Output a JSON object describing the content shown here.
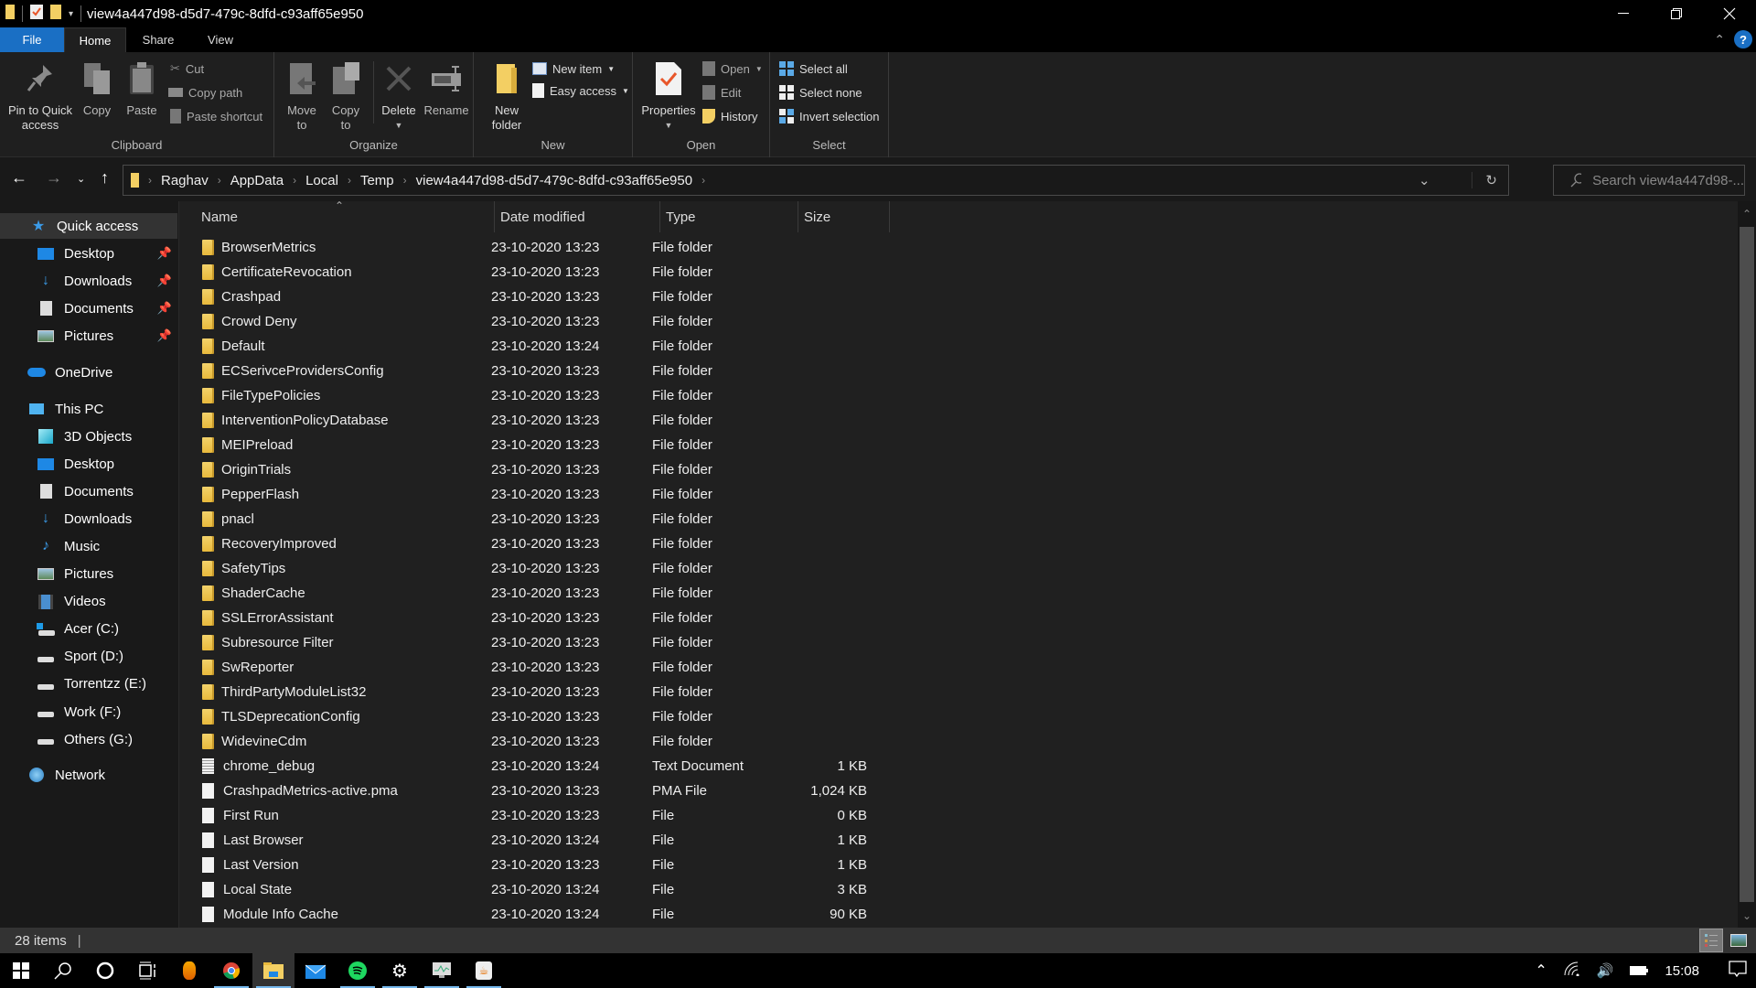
{
  "window": {
    "title": "view4a447d98-d5d7-479c-8dfd-c93aff65e950",
    "controls": {
      "minimize": "minimize-icon",
      "restore": "restore-icon",
      "close": "close-icon"
    }
  },
  "ribbon_tabs": [
    {
      "label": "File"
    },
    {
      "label": "Home",
      "active": true
    },
    {
      "label": "Share"
    },
    {
      "label": "View"
    }
  ],
  "ribbon": {
    "clipboard": {
      "label": "Clipboard",
      "pin": "Pin to Quick access",
      "pin_line1": "Pin to Quick",
      "pin_line2": "access",
      "copy": "Copy",
      "paste": "Paste",
      "cut": "Cut",
      "copy_path": "Copy path",
      "paste_shortcut": "Paste shortcut"
    },
    "organize": {
      "label": "Organize",
      "move_to_1": "Move",
      "move_to_2": "to",
      "copy_to_1": "Copy",
      "copy_to_2": "to",
      "delete": "Delete",
      "rename": "Rename"
    },
    "new": {
      "label": "New",
      "new_folder_1": "New",
      "new_folder_2": "folder",
      "new_item": "New item",
      "easy_access": "Easy access"
    },
    "open": {
      "label": "Open",
      "properties": "Properties",
      "open": "Open",
      "edit": "Edit",
      "history": "History"
    },
    "select": {
      "label": "Select",
      "select_all": "Select all",
      "select_none": "Select none",
      "invert": "Invert selection"
    }
  },
  "address": {
    "breadcrumbs": [
      "Raghav",
      "AppData",
      "Local",
      "Temp",
      "view4a447d98-d5d7-479c-8dfd-c93aff65e950"
    ],
    "search_placeholder": "Search view4a447d98-..."
  },
  "sidebar": {
    "quick_access": "Quick access",
    "quick_items": [
      {
        "label": "Desktop",
        "icon": "desktop-icon",
        "pinned": true
      },
      {
        "label": "Downloads",
        "icon": "downloads-icon",
        "pinned": true
      },
      {
        "label": "Documents",
        "icon": "documents-icon",
        "pinned": true
      },
      {
        "label": "Pictures",
        "icon": "pictures-icon",
        "pinned": true
      }
    ],
    "onedrive": "OneDrive",
    "this_pc": "This PC",
    "pc_items": [
      {
        "label": "3D Objects",
        "icon": "3d-objects-icon"
      },
      {
        "label": "Desktop",
        "icon": "desktop-icon"
      },
      {
        "label": "Documents",
        "icon": "documents-icon"
      },
      {
        "label": "Downloads",
        "icon": "downloads-icon"
      },
      {
        "label": "Music",
        "icon": "music-icon"
      },
      {
        "label": "Pictures",
        "icon": "pictures-icon"
      },
      {
        "label": "Videos",
        "icon": "videos-icon"
      },
      {
        "label": "Acer (C:)",
        "icon": "system-drive-icon"
      },
      {
        "label": "Sport (D:)",
        "icon": "drive-icon"
      },
      {
        "label": "Torrentzz (E:)",
        "icon": "drive-icon"
      },
      {
        "label": "Work (F:)",
        "icon": "drive-icon"
      },
      {
        "label": "Others (G:)",
        "icon": "drive-icon"
      }
    ],
    "network": "Network"
  },
  "columns": {
    "name": "Name",
    "date": "Date modified",
    "type": "Type",
    "size": "Size"
  },
  "files": [
    {
      "name": "BrowserMetrics",
      "date": "23-10-2020 13:23",
      "type": "File folder",
      "size": "",
      "kind": "folder"
    },
    {
      "name": "CertificateRevocation",
      "date": "23-10-2020 13:23",
      "type": "File folder",
      "size": "",
      "kind": "folder"
    },
    {
      "name": "Crashpad",
      "date": "23-10-2020 13:23",
      "type": "File folder",
      "size": "",
      "kind": "folder"
    },
    {
      "name": "Crowd Deny",
      "date": "23-10-2020 13:23",
      "type": "File folder",
      "size": "",
      "kind": "folder"
    },
    {
      "name": "Default",
      "date": "23-10-2020 13:24",
      "type": "File folder",
      "size": "",
      "kind": "folder"
    },
    {
      "name": "ECSerivceProvidersConfig",
      "date": "23-10-2020 13:23",
      "type": "File folder",
      "size": "",
      "kind": "folder"
    },
    {
      "name": "FileTypePolicies",
      "date": "23-10-2020 13:23",
      "type": "File folder",
      "size": "",
      "kind": "folder"
    },
    {
      "name": "InterventionPolicyDatabase",
      "date": "23-10-2020 13:23",
      "type": "File folder",
      "size": "",
      "kind": "folder"
    },
    {
      "name": "MEIPreload",
      "date": "23-10-2020 13:23",
      "type": "File folder",
      "size": "",
      "kind": "folder"
    },
    {
      "name": "OriginTrials",
      "date": "23-10-2020 13:23",
      "type": "File folder",
      "size": "",
      "kind": "folder"
    },
    {
      "name": "PepperFlash",
      "date": "23-10-2020 13:23",
      "type": "File folder",
      "size": "",
      "kind": "folder"
    },
    {
      "name": "pnacl",
      "date": "23-10-2020 13:23",
      "type": "File folder",
      "size": "",
      "kind": "folder"
    },
    {
      "name": "RecoveryImproved",
      "date": "23-10-2020 13:23",
      "type": "File folder",
      "size": "",
      "kind": "folder"
    },
    {
      "name": "SafetyTips",
      "date": "23-10-2020 13:23",
      "type": "File folder",
      "size": "",
      "kind": "folder"
    },
    {
      "name": "ShaderCache",
      "date": "23-10-2020 13:23",
      "type": "File folder",
      "size": "",
      "kind": "folder"
    },
    {
      "name": "SSLErrorAssistant",
      "date": "23-10-2020 13:23",
      "type": "File folder",
      "size": "",
      "kind": "folder"
    },
    {
      "name": "Subresource Filter",
      "date": "23-10-2020 13:23",
      "type": "File folder",
      "size": "",
      "kind": "folder"
    },
    {
      "name": "SwReporter",
      "date": "23-10-2020 13:23",
      "type": "File folder",
      "size": "",
      "kind": "folder"
    },
    {
      "name": "ThirdPartyModuleList32",
      "date": "23-10-2020 13:23",
      "type": "File folder",
      "size": "",
      "kind": "folder"
    },
    {
      "name": "TLSDeprecationConfig",
      "date": "23-10-2020 13:23",
      "type": "File folder",
      "size": "",
      "kind": "folder"
    },
    {
      "name": "WidevineCdm",
      "date": "23-10-2020 13:23",
      "type": "File folder",
      "size": "",
      "kind": "folder"
    },
    {
      "name": "chrome_debug",
      "date": "23-10-2020 13:24",
      "type": "Text Document",
      "size": "1 KB",
      "kind": "text"
    },
    {
      "name": "CrashpadMetrics-active.pma",
      "date": "23-10-2020 13:23",
      "type": "PMA File",
      "size": "1,024 KB",
      "kind": "file"
    },
    {
      "name": "First Run",
      "date": "23-10-2020 13:23",
      "type": "File",
      "size": "0 KB",
      "kind": "file"
    },
    {
      "name": "Last Browser",
      "date": "23-10-2020 13:24",
      "type": "File",
      "size": "1 KB",
      "kind": "file"
    },
    {
      "name": "Last Version",
      "date": "23-10-2020 13:23",
      "type": "File",
      "size": "1 KB",
      "kind": "file"
    },
    {
      "name": "Local State",
      "date": "23-10-2020 13:24",
      "type": "File",
      "size": "3 KB",
      "kind": "file"
    },
    {
      "name": "Module Info Cache",
      "date": "23-10-2020 13:24",
      "type": "File",
      "size": "90 KB",
      "kind": "file"
    }
  ],
  "status": {
    "item_count": "28 items"
  },
  "taskbar": {
    "apps": [
      "start",
      "search",
      "cortana",
      "task-view",
      "fl-studio",
      "chrome",
      "file-explorer",
      "mail",
      "spotify",
      "settings",
      "resource-monitor",
      "java"
    ],
    "clock": "15:08"
  },
  "colors": {
    "accent": "#1a6fc4",
    "folder": "#e8b93c",
    "background": "#202020"
  }
}
